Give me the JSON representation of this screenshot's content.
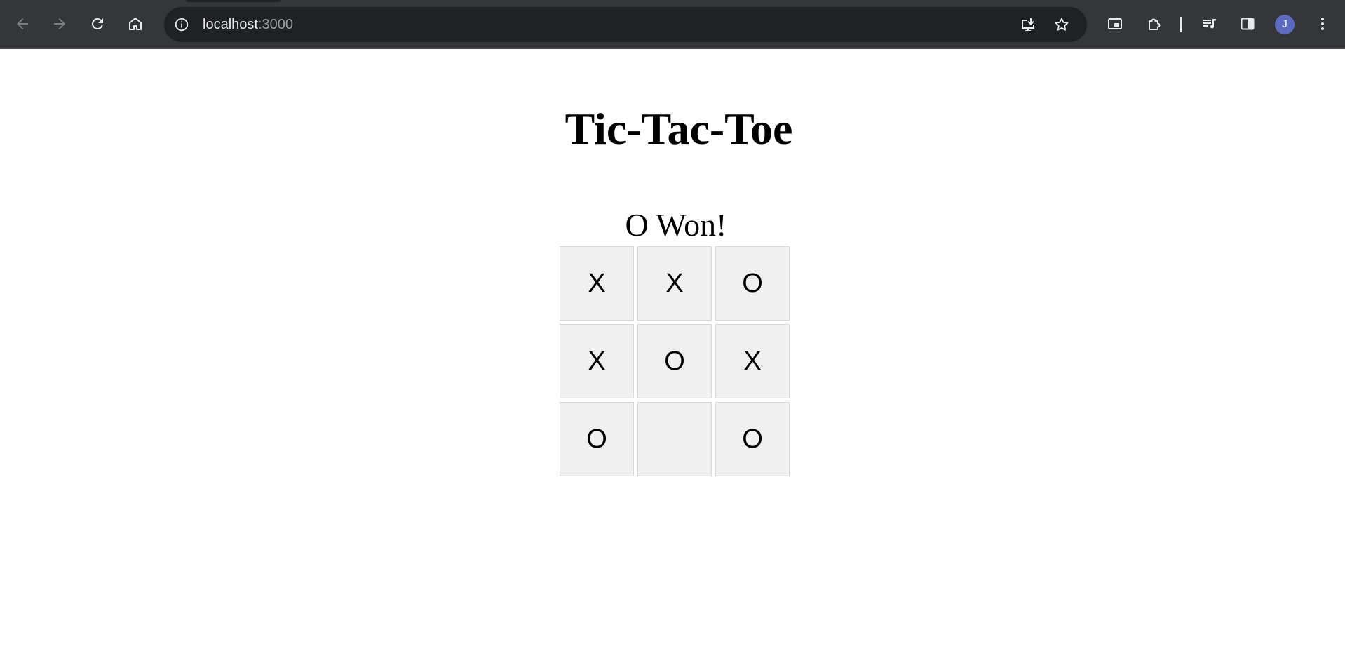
{
  "browser": {
    "url_host": "localhost",
    "url_port": ":3000",
    "profile_initial": "J",
    "icons": {
      "back": "arrow-left-icon",
      "forward": "arrow-right-icon",
      "reload": "reload-icon",
      "home": "home-icon",
      "site_info": "info-icon",
      "install": "install-app-icon",
      "bookmark": "star-icon",
      "pip": "picture-in-picture-icon",
      "extensions": "puzzle-icon",
      "media": "media-queue-icon",
      "side_panel": "side-panel-icon",
      "menu": "kebab-menu-icon"
    }
  },
  "game": {
    "title": "Tic-Tac-Toe",
    "status": "O Won!",
    "board": [
      {
        "value": "X"
      },
      {
        "value": "X"
      },
      {
        "value": "O"
      },
      {
        "value": "X"
      },
      {
        "value": "O"
      },
      {
        "value": "X"
      },
      {
        "value": "O"
      },
      {
        "value": ""
      },
      {
        "value": "O"
      }
    ]
  },
  "colors": {
    "toolbar_bg": "#35363a",
    "omnibox_bg": "#202124",
    "cell_bg": "#f0f0f0",
    "avatar_bg": "#5c6bc0"
  }
}
